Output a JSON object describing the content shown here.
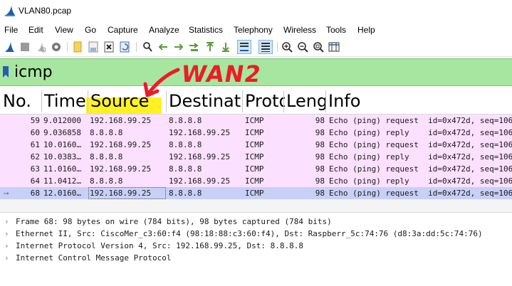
{
  "window": {
    "title": "VLAN80.pcap"
  },
  "menu": [
    "File",
    "Edit",
    "View",
    "Go",
    "Capture",
    "Analyze",
    "Statistics",
    "Telephony",
    "Wireless",
    "Tools",
    "Help"
  ],
  "filter": {
    "value": "icmp"
  },
  "columns": [
    "No.",
    "Time",
    "Source",
    "Destinat",
    "Proto",
    "Leng",
    "Info"
  ],
  "packets": [
    {
      "no": "59",
      "time": "9.012000",
      "source": "192.168.99.25",
      "destination": "8.8.8.8",
      "protocol": "ICMP",
      "length": "98",
      "info": "Echo (ping) request  id=0x472d, seq=106"
    },
    {
      "no": "60",
      "time": "9.036858",
      "source": "8.8.8.8",
      "destination": "192.168.99.25",
      "protocol": "ICMP",
      "length": "98",
      "info": "Echo (ping) reply    id=0x472d, seq=106"
    },
    {
      "no": "61",
      "time": "10.0160…",
      "source": "192.168.99.25",
      "destination": "8.8.8.8",
      "protocol": "ICMP",
      "length": "98",
      "info": "Echo (ping) request  id=0x472d, seq=106"
    },
    {
      "no": "62",
      "time": "10.0383…",
      "source": "8.8.8.8",
      "destination": "192.168.99.25",
      "protocol": "ICMP",
      "length": "98",
      "info": "Echo (ping) reply    id=0x472d, seq=106"
    },
    {
      "no": "63",
      "time": "11.0160…",
      "source": "192.168.99.25",
      "destination": "8.8.8.8",
      "protocol": "ICMP",
      "length": "98",
      "info": "Echo (ping) request  id=0x472d, seq=106"
    },
    {
      "no": "64",
      "time": "11.0412…",
      "source": "8.8.8.8",
      "destination": "192.168.99.25",
      "protocol": "ICMP",
      "length": "98",
      "info": "Echo (ping) reply    id=0x472d, seq=106"
    },
    {
      "no": "68",
      "time": "12.0160…",
      "source": "192.168.99.25",
      "destination": "8.8.8.8",
      "protocol": "ICMP",
      "length": "98",
      "info": "Echo (ping) request  id=0x472d, seq=106"
    }
  ],
  "details": [
    "Frame 68: 98 bytes on wire (784 bits), 98 bytes captured (784 bits)",
    "Ethernet II, Src: CiscoMer_c3:60:f4 (98:18:88:c3:60:f4), Dst: Raspberr_5c:74:76 (d8:3a:dd:5c:74:76)",
    "Internet Protocol Version 4, Src: 192.168.99.25, Dst: 8.8.8.8",
    "Internet Control Message Protocol"
  ],
  "annotation": {
    "text": "WAN2"
  },
  "colors": {
    "filter_bg": "#a6e6a0",
    "icmp_row": "#fce0ff",
    "selected_row": "#c7d0f7",
    "highlight": "#ffee00",
    "annotation": "#ee1b24"
  },
  "icons": [
    "shark-fin-icon",
    "stop-capture-icon",
    "restart-capture-icon",
    "capture-options-icon",
    "open-file-icon",
    "save-file-icon",
    "close-file-icon",
    "reload-file-icon",
    "find-packet-icon",
    "back-icon",
    "forward-icon",
    "go-to-packet-icon",
    "first-packet-icon",
    "last-packet-icon",
    "autoscroll-icon",
    "colorize-icon",
    "zoom-in-icon",
    "zoom-out-icon",
    "normal-size-icon",
    "resize-columns-icon"
  ]
}
